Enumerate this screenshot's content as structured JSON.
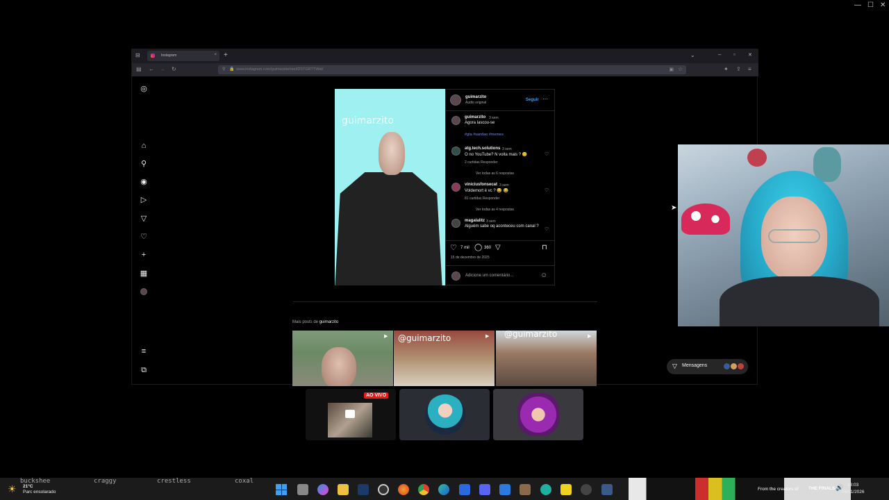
{
  "os": {
    "min": "—",
    "max": "☐",
    "close": "✕"
  },
  "browser": {
    "tab_title": "Instagram",
    "tab_close": "×",
    "new_tab": "+",
    "url": "www.instagram.com/guimarzito/reel/DSTGRTTWat/",
    "win_chevron": "⌄",
    "win_min": "–",
    "win_max": "▫",
    "win_close": "✕"
  },
  "post": {
    "watermark": "guimarzito",
    "author": "guimarzito",
    "audio": "Áudio original",
    "follow": "Seguir",
    "more": "···",
    "caption": {
      "user": "guimarzito",
      "time": "3 sem",
      "text": "Agora lascou-se",
      "tags": "#gta #sandao #memes"
    },
    "comments": [
      {
        "user": "atg.tech.solutions",
        "time": "3 sem",
        "text": "O no YouTube? N volta mais ? 😊",
        "meta": "2 curtidas   Responder",
        "replies": "Ver todas as 6 respostas"
      },
      {
        "user": "viniciusfonsecat",
        "time": "3 sem",
        "text": "Voldemort é vc ? 😂 😂",
        "meta": "81 curtidas   Responder",
        "replies": "Ver todas as 4 respostas"
      },
      {
        "user": "magalalitz",
        "time": "3 sem",
        "text": "Alguém sabe oq aconteceu com canal ?",
        "meta": "1 curtida   Responder",
        "replies": ""
      }
    ],
    "likes": "7 mil",
    "comment_count": "360",
    "date": "15 de dezembro de 2025",
    "add_comment": "Adicione um comentário..."
  },
  "more_posts": {
    "prefix": "Mais posts de ",
    "user": "guimarzito"
  },
  "grid": [
    {
      "watermark": ""
    },
    {
      "watermark": "@guimarzito"
    },
    {
      "watermark": "@guimarzito"
    }
  ],
  "messages": {
    "label": "Mensagens"
  },
  "stream": {
    "live_badge": "AO VIVO"
  },
  "taskbar": {
    "labels": [
      "buckshee",
      "craggy",
      "crestless",
      "coxal"
    ],
    "weather_temp": "21°C",
    "weather_desc": "Parc ensolarado",
    "ad_text": "From the creators of",
    "ad_game": "THE FINALS",
    "time": "18:03",
    "date": "06/01/2026"
  }
}
